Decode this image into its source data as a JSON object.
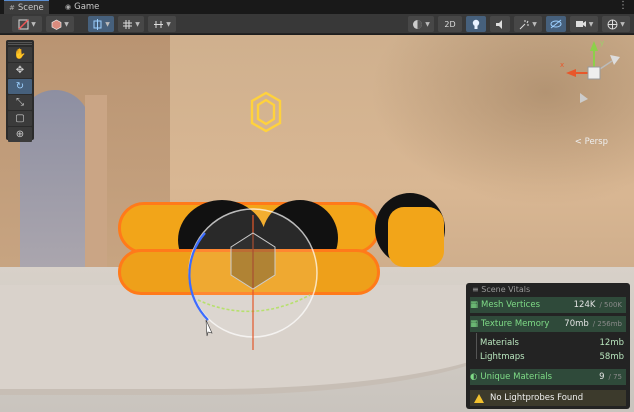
{
  "tabs": [
    {
      "label": "Scene",
      "icon": "grid-icon",
      "active": true
    },
    {
      "label": "Game",
      "icon": "gamepad-icon",
      "active": false
    }
  ],
  "tab_more": "⋮",
  "toolbar": {
    "left": [
      {
        "name": "draw-mode-dropdown",
        "icon": "shading-icon"
      },
      {
        "name": "render-cube-dropdown",
        "icon": "cube-icon"
      },
      {
        "name": "move-snap-dropdown",
        "icon": "snap-icon"
      },
      {
        "name": "grid-dropdown",
        "icon": "grid-snap-icon"
      },
      {
        "name": "increment-dropdown",
        "icon": "increment-icon"
      }
    ],
    "right": [
      {
        "name": "shading-sphere-dropdown",
        "icon": "sphere-icon"
      },
      {
        "name": "2d-toggle",
        "label": "2D"
      },
      {
        "name": "lighting-toggle",
        "icon": "bulb-icon"
      },
      {
        "name": "audio-toggle",
        "icon": "audio-icon"
      },
      {
        "name": "effects-dropdown",
        "icon": "effects-icon"
      },
      {
        "name": "hidden-objects-toggle",
        "icon": "eye-slash-icon"
      },
      {
        "name": "camera-dropdown",
        "icon": "camera-icon"
      },
      {
        "name": "gizmos-dropdown",
        "icon": "globe-icon"
      }
    ]
  },
  "tools": [
    {
      "name": "hand-tool",
      "icon": "✋",
      "active": false
    },
    {
      "name": "move-tool",
      "icon": "✥",
      "active": false
    },
    {
      "name": "rotate-tool",
      "icon": "↻",
      "active": true
    },
    {
      "name": "scale-tool",
      "icon": "⤡",
      "active": false
    },
    {
      "name": "rect-tool",
      "icon": "▢",
      "active": false
    },
    {
      "name": "transform-tool",
      "icon": "⊕",
      "active": false
    }
  ],
  "gizmo": {
    "persp_label": "< Persp",
    "axis_y": "y",
    "axis_x": "x"
  },
  "vitals": {
    "title": "Scene Vitals",
    "mesh": {
      "label": "Mesh Vertices",
      "value": "124K",
      "limit": "/ 500K"
    },
    "texture": {
      "label": "Texture Memory",
      "value": "70mb",
      "limit": "/ 256mb"
    },
    "materials": {
      "label": "Materials",
      "value": "12mb"
    },
    "lightmaps": {
      "label": "Lightmaps",
      "value": "58mb"
    },
    "unique": {
      "label": "Unique Materials",
      "value": "9",
      "limit": "/ 75"
    },
    "warning": "No Lightprobes Found"
  },
  "colors": {
    "accent": "#46607c",
    "selection_outline": "#ff7a1a",
    "ok_green": "#7fdc87",
    "warning_yellow": "#f2c12e"
  }
}
